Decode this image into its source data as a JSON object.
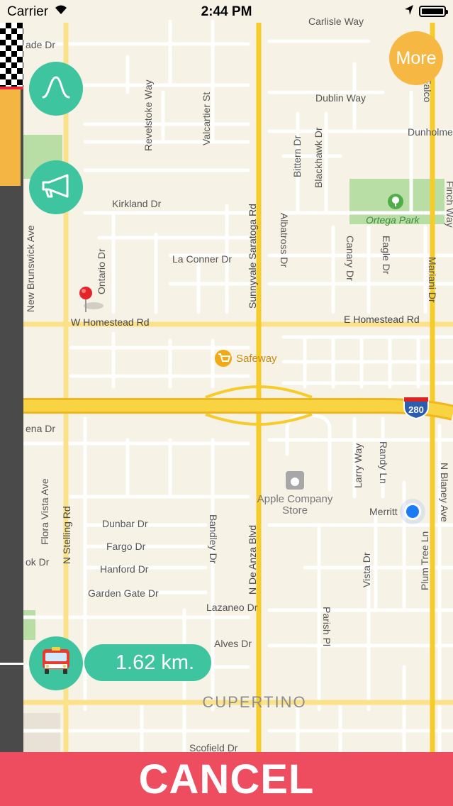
{
  "status_bar": {
    "carrier": "Carrier",
    "time": "2:44 PM",
    "wifi_icon": "wifi-icon",
    "location_icon": "location-arrow-icon",
    "battery_icon": "battery-icon"
  },
  "map": {
    "streets": {
      "ade_dr": "ade Dr",
      "carlisle_way": "Carlisle Way",
      "dublin_way": "Dublin Way",
      "dunholme": "Dunholme",
      "revelstoke_way": "Revelstoke Way",
      "valcartier_st": "Valcartier St",
      "bittern_dr": "Bittern Dr",
      "blackhawk_dr": "Blackhawk Dr",
      "albatross_dr": "Albatross Dr",
      "sunnyvale_saratoga_rd": "Sunnyvale Saratoga Rd",
      "kirkland_dr": "Kirkland Dr",
      "la_conner_dr": "La Conner Dr",
      "ontario_dr": "Ontario Dr",
      "new_brunswick_ave": "New Brunswick Ave",
      "w_homestead_rd": "W Homestead Rd",
      "e_homestead_rd": "E Homestead Rd",
      "canary_dr": "Canary Dr",
      "eagle_dr": "Eagle Dr",
      "mariani_dr": "Mariani Dr",
      "finch_way": "Finch Way",
      "falcon": "Falco",
      "larry_way": "Larry Way",
      "randy_ln": "Randy Ln",
      "merritt": "Merritt",
      "blaney": "N Blaney Ave",
      "n_stelling_rd": "N Stelling Rd",
      "flora_vista_ave": "Flora Vista Ave",
      "dunbar_dr": "Dunbar Dr",
      "fargo_dr": "Fargo Dr",
      "hanford_dr": "Hanford Dr",
      "garden_gate_dr": "Garden Gate Dr",
      "bandley_dr": "Bandley Dr",
      "n_de_anza_blvd": "N De Anza Blvd",
      "lazaneo_dr": "Lazaneo Dr",
      "alves_dr": "Alves Dr",
      "parish_pl": "Parish Pl",
      "vista_dr": "Vista Dr",
      "plum_tree_ln": "Plum Tree Ln",
      "scofield_dr": "Scofield Dr",
      "ena_dr": "ena Dr",
      "ok_dr": "ok Dr"
    },
    "places": {
      "ortega_park": "Ortega Park",
      "safeway": "Safeway",
      "apple_store_line1": "Apple Company",
      "apple_store_line2": "Store",
      "cupertino": "CUPERTINO"
    },
    "highway_shield": "280",
    "destination_pin_icon": "map-pin-icon",
    "current_location_icon": "current-location-dot-icon"
  },
  "progress": {
    "completed_fraction": 0.13
  },
  "controls": {
    "route_button_icon": "route-curve-icon",
    "sound_button_icon": "megaphone-icon",
    "more_label": "More",
    "vehicle_icon": "fire-truck-icon",
    "distance": "1.62 km.",
    "cancel_label": "CANCEL"
  },
  "colors": {
    "accent_green": "#3fc4a0",
    "accent_orange": "#f6b843",
    "cancel_red": "#ee4d5f",
    "highway_yellow": "#f6cc2b",
    "map_background": "#f7f2e6"
  }
}
